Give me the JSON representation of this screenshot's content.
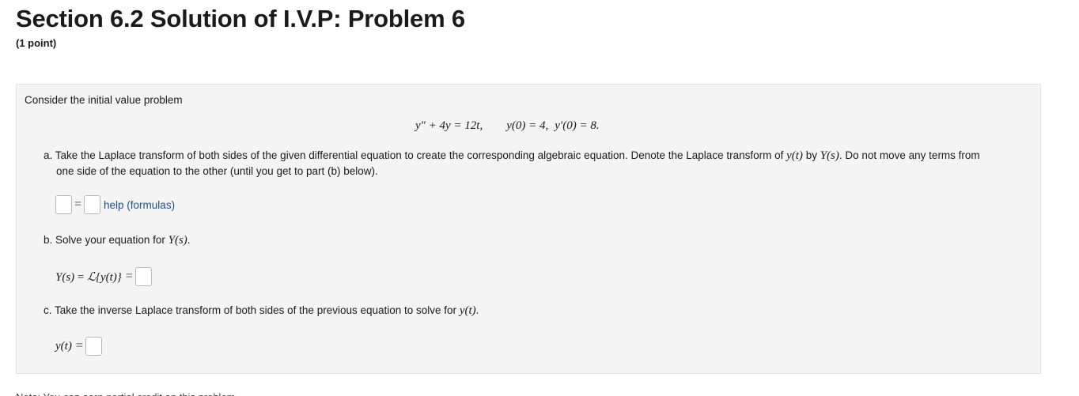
{
  "header": {
    "title": "Section 6.2 Solution of I.V.P: Problem 6",
    "points": "(1 point)"
  },
  "problem": {
    "intro": "Consider the initial value problem",
    "equation": {
      "ode": "y″ + 4y = 12t,",
      "ic1": "y(0) = 4,",
      "ic2": "y′(0) = 8."
    },
    "part_a": {
      "line1": "a. Take the Laplace transform of both sides of the given differential equation to create the corresponding algebraic equation. Denote the Laplace transform of ",
      "yt": "y(t)",
      "mid": " by ",
      "Ys": "Y(s)",
      "end": ". Do not move any terms from",
      "line2": "one side of the equation to the other (until you get to part (b) below).",
      "help_label": "help (formulas)",
      "equals": "="
    },
    "part_b": {
      "text": "b. Solve your equation for ",
      "Ys": "Y(s)",
      "period": ".",
      "lhs_Y": "Y(s)",
      "lhs_eq1": " = ",
      "lhs_L": "ℒ",
      "lhs_arg": "{y(t)}",
      "equals": "="
    },
    "part_c": {
      "text": "c. Take the inverse Laplace transform of both sides of the previous equation to solve for ",
      "yt": "y(t)",
      "period": ".",
      "lhs": "y(t)",
      "equals": "="
    }
  },
  "footer": {
    "cutoff_text": "Note: You can earn partial credit on this problem."
  }
}
